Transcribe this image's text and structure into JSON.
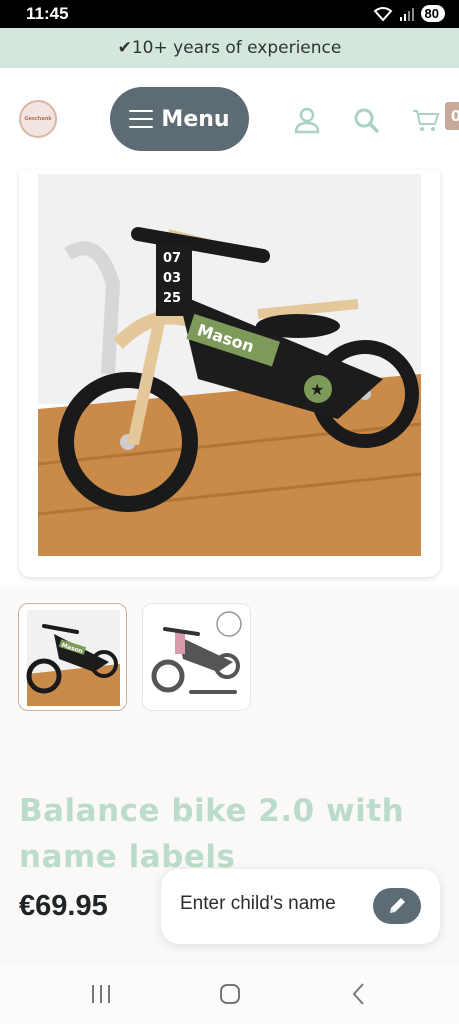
{
  "status_bar": {
    "time": "11:45",
    "battery": "80",
    "icons": [
      "wifi-icon",
      "signal-icon",
      "battery-icon"
    ]
  },
  "promo": {
    "text": "✔10+ years of experience"
  },
  "header": {
    "logo_text": "Geschenk",
    "menu_label": "Menu",
    "cart_count": "0",
    "icons": [
      "hamburger-icon",
      "user-icon",
      "search-icon",
      "cart-icon"
    ]
  },
  "gallery": {
    "main_image": {
      "alt": "Balance bike with name labels",
      "name_label": "Mason",
      "date_lines": [
        "07",
        "03",
        "25"
      ]
    },
    "thumbnails": [
      {
        "label": "Mason",
        "active": true
      },
      {
        "label": "",
        "active": false
      }
    ]
  },
  "product": {
    "title": "Balance bike 2.0 with name labels",
    "price": "€69.95"
  },
  "name_cta": {
    "label": "Enter child's name",
    "icon": "pencil-icon"
  },
  "colors": {
    "accent": "#5d6c74",
    "title_green": "#bcdccb",
    "promo_bg": "#d4e7dc",
    "icon_green": "#a9d3c0",
    "bike_green": "#7e9a5a"
  },
  "nav_bar": {
    "icons": [
      "recent-apps-icon",
      "home-icon",
      "back-icon"
    ]
  }
}
